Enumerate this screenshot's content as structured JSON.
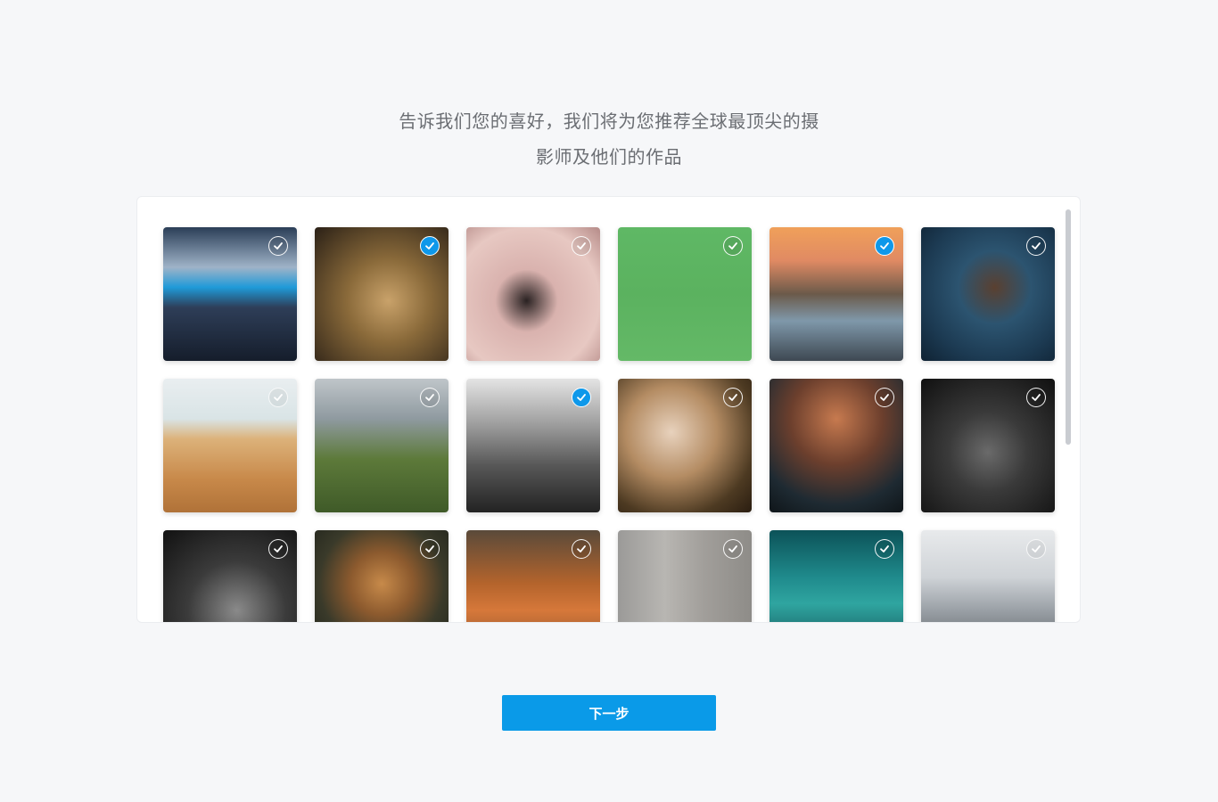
{
  "headline": {
    "line1": "告诉我们您的喜好，我们将为您推荐全球最顶尖的摄",
    "line2": "影师及他们的作品"
  },
  "photos": [
    {
      "subject": "iceberg-waves",
      "selected": false,
      "bg": "linear-gradient(180deg,#2b3e57 0%,#9fb3c8 30%,#1f9ad8 45%,#2e3e58 60%,#151d2b 100%)"
    },
    {
      "subject": "lions-bird",
      "selected": true,
      "bg": "radial-gradient(circle at 55% 55%,#c9a26a 0%,#8a6a3a 40%,#2a2016 100%)"
    },
    {
      "subject": "woman-pink-tulle",
      "selected": false,
      "bg": "radial-gradient(circle at 45% 55%,#2a2222 0%,#d9b2ae 30%,#e7c8c2 70%,#b58b88 100%)"
    },
    {
      "subject": "insects-branch",
      "selected": false,
      "bg": "linear-gradient(180deg,#5fb865 0%,#5bb25f 50%,#64b967 100%)"
    },
    {
      "subject": "couple-coast-sunset",
      "selected": true,
      "bg": "linear-gradient(180deg,#f0a05a 0%,#e08a63 25%,#6b5a4a 50%,#7f98aa 70%,#3e4852 100%)"
    },
    {
      "subject": "dancer-braids",
      "selected": false,
      "bg": "radial-gradient(circle at 55% 45%,#5a4030 0%,#2c5470 35%,#1c3a52 70%,#0f2233 100%)"
    },
    {
      "subject": "desert-dunes",
      "selected": false,
      "bg": "linear-gradient(180deg,#e9eef0 0%,#d9e4e6 30%,#dcb27a 45%,#c8894a 75%,#b07238 100%)"
    },
    {
      "subject": "machu-picchu",
      "selected": false,
      "bg": "linear-gradient(180deg,#bfc5c9 0%,#8f9aa0 30%,#5d7a3a 60%,#3f5a28 100%)"
    },
    {
      "subject": "street-bw",
      "selected": true,
      "bg": "linear-gradient(180deg,#e4e4e4 0%,#9c9c9c 35%,#575757 65%,#232323 100%)"
    },
    {
      "subject": "blonde-woman-portrait",
      "selected": false,
      "bg": "radial-gradient(circle at 40% 40%,#e8d2bd 0%,#b48c63 40%,#4d3a22 75%,#2a1d10 100%)"
    },
    {
      "subject": "rock-concert",
      "selected": false,
      "bg": "radial-gradient(circle at 50% 30%,#c77a4f 0%,#6c3f2d 40%,#1e2a32 75%,#0f1519 100%)"
    },
    {
      "subject": "bw-portrait-woman",
      "selected": false,
      "bg": "radial-gradient(circle at 50% 55%,#6a6a6a 0%,#3a3a3a 40%,#101010 100%)"
    },
    {
      "subject": "dancer-powder-bw",
      "selected": false,
      "bg": "radial-gradient(circle at 55% 60%,#8a8a8a 0%,#3b3b3b 45%,#111111 100%)"
    },
    {
      "subject": "food-platter",
      "selected": false,
      "bg": "radial-gradient(circle at 50% 40%,#c78a4a 0%,#8c5a2e 30%,#3a3a2a 60%,#1a1e18 100%)"
    },
    {
      "subject": "vintage-car",
      "selected": false,
      "bg": "linear-gradient(180deg,#5a4a3a 0%,#b4642c 40%,#d6783a 60%,#7a4a2a 100%)"
    },
    {
      "subject": "building-facade",
      "selected": false,
      "bg": "linear-gradient(90deg,#9b9a98 0%,#b8b6b2 35%,#a19e9a 65%,#8e8c88 100%)"
    },
    {
      "subject": "ocean-wave",
      "selected": false,
      "bg": "linear-gradient(180deg,#0c5258 0%,#1f8a8c 35%,#2fa5a0 55%,#0d3c44 100%)"
    },
    {
      "subject": "mountain-hut",
      "selected": false,
      "bg": "linear-gradient(180deg,#e8eaec 0%,#cfd3d7 35%,#9aa0a6 60%,#4a4d50 100%)"
    }
  ],
  "next_button": {
    "label": "下一步"
  },
  "colors": {
    "accent": "#0a9ae8",
    "check_selected": "#0e98ea",
    "background": "#f6f7f9"
  }
}
